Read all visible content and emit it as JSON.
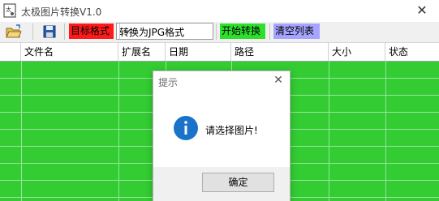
{
  "window": {
    "title": "太极图片转换V1.0"
  },
  "toolbar": {
    "open_icon": "folder-open-icon",
    "save_icon": "save-disk-icon",
    "target_format_label": "目标格式",
    "format_select_value": "转换为JPG格式",
    "start_label": "开始转换",
    "clear_label": "清空列表"
  },
  "grid": {
    "columns": [
      "文件名",
      "扩展名",
      "日期",
      "路径",
      "大小",
      "状态"
    ]
  },
  "dialog": {
    "title": "提示",
    "message": "请选择图片!",
    "ok_label": "确定"
  },
  "colors": {
    "grid_green": "#33cc33",
    "target_red": "#ff1a1a",
    "start_green": "#2ee02e",
    "clear_blue": "#a5a5ff",
    "info_blue": "#1a73c9"
  }
}
